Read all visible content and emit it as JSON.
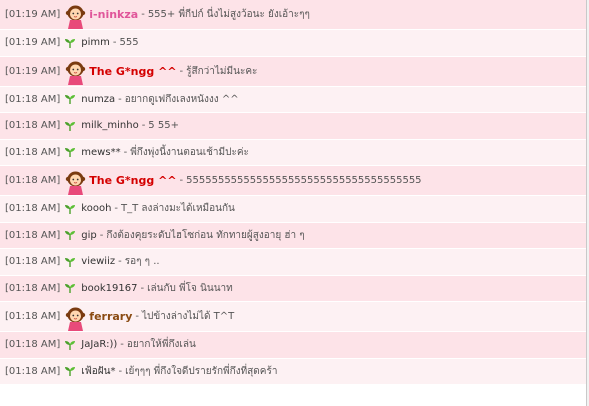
{
  "messages": [
    {
      "time": "[01:19 AM]",
      "name": "i-ninkza",
      "text": "555+ พี่กีปก์ นี่งไม่สูงว้อนะ ยังเอ้าะๆๆ",
      "style": "pink",
      "icon": "avatar"
    },
    {
      "time": "[01:19 AM]",
      "name": "pimm",
      "text": "555",
      "style": "plain",
      "icon": "sprout"
    },
    {
      "time": "[01:19 AM]",
      "name": "The G*ngg ^^",
      "text": "รู้สึกว่าไม่มีนะคะ",
      "style": "bold-red",
      "icon": "avatar"
    },
    {
      "time": "[01:18 AM]",
      "name": "numza",
      "text": "อยากดูเฟกึงเลงหนังงง ^^",
      "style": "plain",
      "icon": "sprout"
    },
    {
      "time": "[01:18 AM]",
      "name": "milk_minho",
      "text": "5 55+",
      "style": "plain",
      "icon": "sprout"
    },
    {
      "time": "[01:18 AM]",
      "name": "mews**",
      "text": "พี่กึงพุ่งนี้งานตอนเช้ามีปะค่ะ",
      "style": "plain",
      "icon": "sprout"
    },
    {
      "time": "[01:18 AM]",
      "name": "The G*ngg ^^",
      "text": "5555555555555555555555555555555555555",
      "style": "bold-red",
      "icon": "avatar"
    },
    {
      "time": "[01:18 AM]",
      "name": "koooh",
      "text": "T_T ลงล่างมะได้เหมือนกัน",
      "style": "plain",
      "icon": "sprout"
    },
    {
      "time": "[01:18 AM]",
      "name": "gip",
      "text": "กึงต้องคุยระดับไฮโซก่อน ทักทายผู้สูงอายุ ฮ่า ๆ",
      "style": "plain",
      "icon": "sprout"
    },
    {
      "time": "[01:18 AM]",
      "name": "viewiiz",
      "text": "รอๆ ๆ ..",
      "style": "plain",
      "icon": "sprout"
    },
    {
      "time": "[01:18 AM]",
      "name": "book19167",
      "text": "เล่นกับ พี่โจ นินนาท",
      "style": "plain",
      "icon": "sprout"
    },
    {
      "time": "[01:18 AM]",
      "name": "ferrary",
      "text": "ไปข้างล่างไม่ได้ T^T",
      "style": "brown",
      "icon": "avatar"
    },
    {
      "time": "[01:18 AM]",
      "name": "JaJaR:))",
      "text": "อยากให้พี่กึงเล่น",
      "style": "plain",
      "icon": "sprout"
    },
    {
      "time": "[01:18 AM]",
      "name": "เฟ้อฝัน*",
      "text": "เย้ๆๆๆ พี่กึงใจดีปรายรักพี่กึงที่สุดคร้า",
      "style": "plain",
      "icon": "sprout"
    }
  ],
  "separator": "-",
  "colors": {
    "row_dark": "#fde3e8",
    "row_light": "#fdf1f3",
    "name_red": "#d40000",
    "name_pink": "#e0569a",
    "name_brown": "#8a4b12",
    "sprout": "#4aa12a"
  }
}
